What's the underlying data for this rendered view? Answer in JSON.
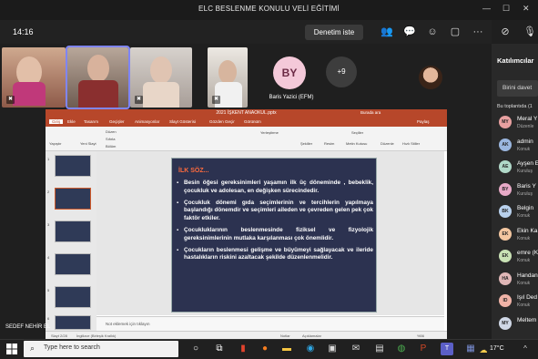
{
  "window": {
    "title": "ELC BESLENME KONULU VELİ EĞİTİMİ"
  },
  "meeting": {
    "timer": "14:16",
    "pin_label": "Denetim iste"
  },
  "participants_row": {
    "avatar_initials": "BY",
    "avatar_name": "Baris Yazici (EFM)",
    "overflow_count": "+9"
  },
  "ppt": {
    "title": "2021 İŞKENT ANAOKUL.pptx",
    "search_hint": "Burada ara",
    "share_label": "Paylaş",
    "tabs": [
      "Giriş",
      "Ekle",
      "Tasarım",
      "Geçişler",
      "Animasyonlar",
      "Slayt Gösterisi",
      "Gözden Geçir",
      "Görünüm"
    ],
    "ribbon": [
      "Yapıştır",
      "Yeni Slayt",
      "Düzen",
      "Sıfırla",
      "Bölüm",
      "Resim",
      "Metin Kutusu",
      "Düzenle",
      "Seçiller",
      "Şekiller",
      "Yerleştirme",
      "Hızlı Stiller"
    ],
    "thumb_numbers": [
      "1",
      "2",
      "3",
      "4",
      "5",
      "6",
      "7"
    ],
    "notes_placeholder": "Not eklemek için tıklayın",
    "status_left": "Slayt 2/28",
    "status_lang": "İngilizce (Birleşik Krallık)",
    "status_notes": "Notlar",
    "status_comments": "Açıklamalar",
    "status_zoom": "%56"
  },
  "slide": {
    "heading": "İLK SÖZ...",
    "bullets": [
      "Besin öğesi gereksinimleri yaşamın ilk üç döneminde , bebeklik, çocukluk ve adolesan, en değişken sürecindedir.",
      "Çocukluk dönemi gıda seçimlerinin ve tercihlerin yapılmaya başlandığı dönemdir ve seçimleri aileden ve çevreden gelen pek çok faktör etkiler.",
      "Çocukluklarının beslenmesinde fiziksel ve fizyolojik gereksinimlerinin mutlaka karşılanması çok önemlidir.",
      "Çocukların beslenmesi gelişme ve büyümeyi sağlayacak ve ileride hastalıkların riskini azaltacak şekilde düzenlenmelidir."
    ]
  },
  "sharer_name": "SEDEF NEHİR EL",
  "panel": {
    "title": "Katılımcılar",
    "invite_placeholder": "Birini davet",
    "section": "Bu toplantıda (1",
    "people": [
      {
        "initials": "MY",
        "name": "Meral Y",
        "role": "Düzenle",
        "color": "#e8a0a0"
      },
      {
        "initials": "AK",
        "name": "admin",
        "role": "Konuk",
        "color": "#9bb7e0"
      },
      {
        "initials": "AE",
        "name": "Ayşen E",
        "role": "Kuruluş",
        "color": "#b0d8c8"
      },
      {
        "initials": "BY",
        "name": "Baris Y",
        "role": "Kuruluş",
        "color": "#e7a9c6"
      },
      {
        "initials": "BK",
        "name": "Belgin",
        "role": "Konuk",
        "color": "#b8d0ec"
      },
      {
        "initials": "EK",
        "name": "Ekin Ka",
        "role": "Konuk",
        "color": "#f3c6a0"
      },
      {
        "initials": "EK",
        "name": "emre (K",
        "role": "Konuk",
        "color": "#c9e2b5"
      },
      {
        "initials": "HA",
        "name": "Handan",
        "role": "Konuk",
        "color": "#e0b7b7"
      },
      {
        "initials": "ID",
        "name": "Işıl Ded",
        "role": "Konuk",
        "color": "#f0b3a7"
      },
      {
        "initials": "MY",
        "name": "Meltem",
        "role": "",
        "color": "#cfd7e6"
      }
    ]
  },
  "taskbar": {
    "search_placeholder": "Type here to search",
    "temp": "17°C"
  }
}
